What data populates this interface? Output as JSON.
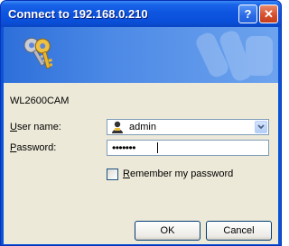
{
  "window": {
    "title": "Connect to 192.168.0.210",
    "help_glyph": "?",
    "close_glyph": "✕"
  },
  "banner": {
    "icon": "keys-icon",
    "watermark_icon": "keys-watermark-icon"
  },
  "form": {
    "server_name": "WL2600CAM",
    "username_label_accel": "U",
    "username_label_rest": "ser name:",
    "username_value": "admin",
    "password_label_accel": "P",
    "password_label_rest": "assword:",
    "password_mask": "•••••••",
    "remember_label_accel": "R",
    "remember_label_rest": "emember my password",
    "remember_checked": false
  },
  "buttons": {
    "ok_label": "OK",
    "cancel_label": "Cancel"
  },
  "colors": {
    "titlebar": "#0a53d6",
    "client_bg": "#ece9d8",
    "close_button": "#d6512f"
  }
}
